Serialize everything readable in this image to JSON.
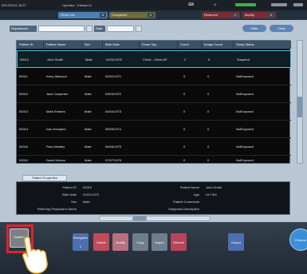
{
  "topbar": {
    "datetime": "09/12/2011 16:27",
    "operator": "Operator : Edward N",
    "icons": [
      "keyboard-icon",
      "person-icon",
      "battery-icon",
      "bar-gauge-icon"
    ]
  },
  "tabs": [
    {
      "label": "Order List",
      "count": "5",
      "color": "#5aa6e6"
    },
    {
      "label": "Completed",
      "count": "0",
      "color": "#d9c650"
    },
    {
      "label": "Reserved",
      "count": "1",
      "color": "#e04848"
    },
    {
      "label": "Modify",
      "count": "0",
      "color": "#e04848"
    }
  ],
  "search": {
    "department_label": "Department",
    "date_label": "Date",
    "filter_label": "Filter",
    "clear_label": "Clear"
  },
  "list": {
    "columns": [
      "Patient ID",
      "Patient Name",
      "Sex",
      "Birth Date",
      "Exam Tag",
      "Count",
      "Image Count",
      "Study Status"
    ],
    "rows": [
      [
        "00010",
        "John Smith",
        "Male",
        "01/01/1970",
        "Chest - Chest AP",
        "2",
        "0",
        "Suspend"
      ],
      [
        "00011",
        "Kerry Atkinson",
        "Male",
        "02/02/1971",
        "",
        "0",
        "0",
        "NotExposed"
      ],
      [
        "00012",
        "Jack Carpenter",
        "Male",
        "03/03/1972",
        "",
        "0",
        "0",
        "NotExposed"
      ],
      [
        "00013",
        "Mark Embers",
        "Male",
        "04/04/1973",
        "",
        "0",
        "0",
        "NotExposed"
      ],
      [
        "00014",
        "Ivan Kempton",
        "Male",
        "05/05/1974",
        "",
        "0",
        "0",
        "NotExposed"
      ],
      [
        "00015",
        "Paul Westley",
        "Male",
        "06/06/1975",
        "",
        "0",
        "0",
        "NotExposed"
      ],
      [
        "00016",
        "David Nelson",
        "Male",
        "07/07/1976",
        "",
        "0",
        "0",
        "NotExposed"
      ]
    ]
  },
  "detail": {
    "tab_label": "Patient Properties",
    "left": [
      {
        "label": "Patient ID",
        "value": "00010"
      },
      {
        "label": "Birth Date",
        "value": "01/01/1970"
      },
      {
        "label": "Sex",
        "value": "Male"
      },
      {
        "label": "Referring Physician's Name",
        "value": ""
      }
    ],
    "right": [
      {
        "label": "Patient Name",
        "value": "John Smith"
      },
      {
        "label": "Age",
        "value": "41Y 8M"
      },
      {
        "label": "Patient Comments",
        "value": ""
      },
      {
        "label": "Diagnosis Description",
        "value": ""
      }
    ]
  },
  "buttons": {
    "system": "System",
    "register": "Reregister",
    "delete": "Delete",
    "modify": "Modify",
    "copy": "Copy",
    "import": "Import",
    "refresh": "Refresh",
    "output": "Output",
    "perform": "Perform"
  },
  "register_count": "1",
  "colors": {
    "selection": "#49c0e0",
    "highlight_frame": "#e0232b",
    "delete": "#c24a5c",
    "modify": "#c06f7d",
    "refresh": "#b6455a",
    "perform": "#3a8fd6"
  }
}
